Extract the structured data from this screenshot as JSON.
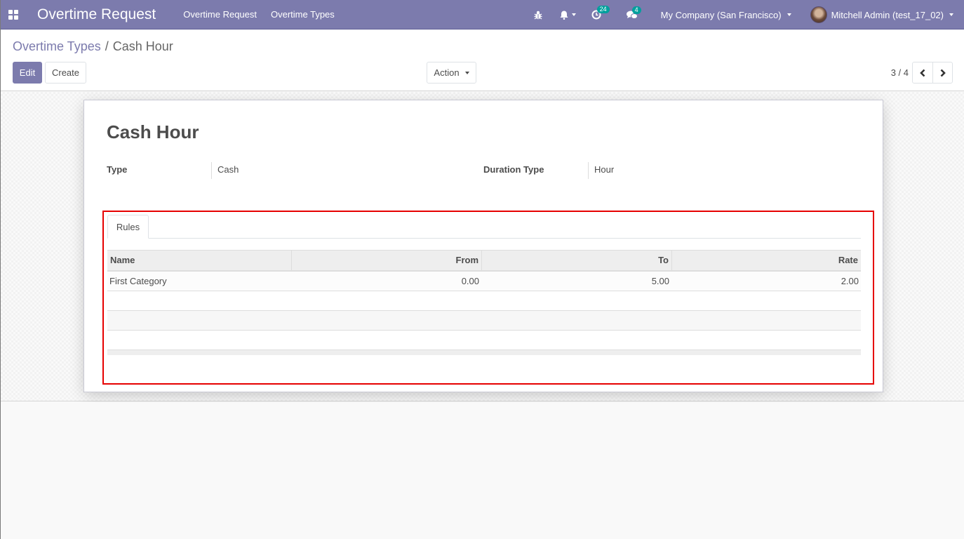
{
  "navbar": {
    "app_title": "Overtime Request",
    "menu": [
      "Overtime Request",
      "Overtime Types"
    ],
    "activity_badge": "24",
    "messages_badge": "4",
    "company": "My Company (San Francisco)",
    "user": "Mitchell Admin (test_17_02)"
  },
  "breadcrumb": {
    "parent": "Overtime Types",
    "separator": "/",
    "current": "Cash Hour"
  },
  "toolbar": {
    "edit_label": "Edit",
    "create_label": "Create",
    "action_label": "Action",
    "pager_value": "3 / 4"
  },
  "form": {
    "title": "Cash Hour",
    "fields": {
      "type_label": "Type",
      "type_value": "Cash",
      "duration_label": "Duration Type",
      "duration_value": "Hour"
    },
    "tabs": [
      "Rules"
    ],
    "rules_table": {
      "columns": [
        "Name",
        "From",
        "To",
        "Rate"
      ],
      "rows": [
        {
          "name": "First Category",
          "from": "0.00",
          "to": "5.00",
          "rate": "2.00"
        }
      ]
    }
  },
  "colors": {
    "brand": "#7c7bad",
    "badge": "#00a09d",
    "highlight": "#e60000"
  }
}
